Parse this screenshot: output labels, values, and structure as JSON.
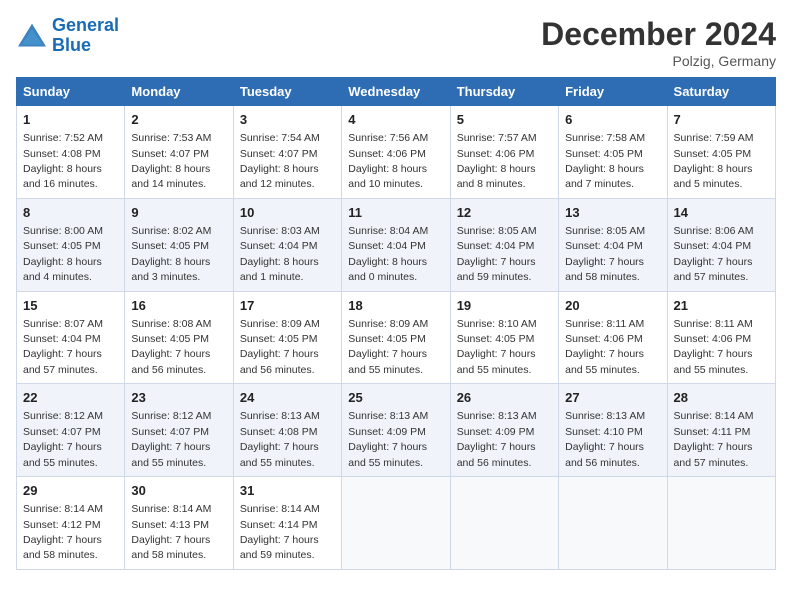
{
  "header": {
    "logo_general": "General",
    "logo_blue": "Blue",
    "month_title": "December 2024",
    "location": "Polzig, Germany"
  },
  "days_of_week": [
    "Sunday",
    "Monday",
    "Tuesday",
    "Wednesday",
    "Thursday",
    "Friday",
    "Saturday"
  ],
  "weeks": [
    [
      {
        "day": "1",
        "sunrise": "Sunrise: 7:52 AM",
        "sunset": "Sunset: 4:08 PM",
        "daylight": "Daylight: 8 hours and 16 minutes."
      },
      {
        "day": "2",
        "sunrise": "Sunrise: 7:53 AM",
        "sunset": "Sunset: 4:07 PM",
        "daylight": "Daylight: 8 hours and 14 minutes."
      },
      {
        "day": "3",
        "sunrise": "Sunrise: 7:54 AM",
        "sunset": "Sunset: 4:07 PM",
        "daylight": "Daylight: 8 hours and 12 minutes."
      },
      {
        "day": "4",
        "sunrise": "Sunrise: 7:56 AM",
        "sunset": "Sunset: 4:06 PM",
        "daylight": "Daylight: 8 hours and 10 minutes."
      },
      {
        "day": "5",
        "sunrise": "Sunrise: 7:57 AM",
        "sunset": "Sunset: 4:06 PM",
        "daylight": "Daylight: 8 hours and 8 minutes."
      },
      {
        "day": "6",
        "sunrise": "Sunrise: 7:58 AM",
        "sunset": "Sunset: 4:05 PM",
        "daylight": "Daylight: 8 hours and 7 minutes."
      },
      {
        "day": "7",
        "sunrise": "Sunrise: 7:59 AM",
        "sunset": "Sunset: 4:05 PM",
        "daylight": "Daylight: 8 hours and 5 minutes."
      }
    ],
    [
      {
        "day": "8",
        "sunrise": "Sunrise: 8:00 AM",
        "sunset": "Sunset: 4:05 PM",
        "daylight": "Daylight: 8 hours and 4 minutes."
      },
      {
        "day": "9",
        "sunrise": "Sunrise: 8:02 AM",
        "sunset": "Sunset: 4:05 PM",
        "daylight": "Daylight: 8 hours and 3 minutes."
      },
      {
        "day": "10",
        "sunrise": "Sunrise: 8:03 AM",
        "sunset": "Sunset: 4:04 PM",
        "daylight": "Daylight: 8 hours and 1 minute."
      },
      {
        "day": "11",
        "sunrise": "Sunrise: 8:04 AM",
        "sunset": "Sunset: 4:04 PM",
        "daylight": "Daylight: 8 hours and 0 minutes."
      },
      {
        "day": "12",
        "sunrise": "Sunrise: 8:05 AM",
        "sunset": "Sunset: 4:04 PM",
        "daylight": "Daylight: 7 hours and 59 minutes."
      },
      {
        "day": "13",
        "sunrise": "Sunrise: 8:05 AM",
        "sunset": "Sunset: 4:04 PM",
        "daylight": "Daylight: 7 hours and 58 minutes."
      },
      {
        "day": "14",
        "sunrise": "Sunrise: 8:06 AM",
        "sunset": "Sunset: 4:04 PM",
        "daylight": "Daylight: 7 hours and 57 minutes."
      }
    ],
    [
      {
        "day": "15",
        "sunrise": "Sunrise: 8:07 AM",
        "sunset": "Sunset: 4:04 PM",
        "daylight": "Daylight: 7 hours and 57 minutes."
      },
      {
        "day": "16",
        "sunrise": "Sunrise: 8:08 AM",
        "sunset": "Sunset: 4:05 PM",
        "daylight": "Daylight: 7 hours and 56 minutes."
      },
      {
        "day": "17",
        "sunrise": "Sunrise: 8:09 AM",
        "sunset": "Sunset: 4:05 PM",
        "daylight": "Daylight: 7 hours and 56 minutes."
      },
      {
        "day": "18",
        "sunrise": "Sunrise: 8:09 AM",
        "sunset": "Sunset: 4:05 PM",
        "daylight": "Daylight: 7 hours and 55 minutes."
      },
      {
        "day": "19",
        "sunrise": "Sunrise: 8:10 AM",
        "sunset": "Sunset: 4:05 PM",
        "daylight": "Daylight: 7 hours and 55 minutes."
      },
      {
        "day": "20",
        "sunrise": "Sunrise: 8:11 AM",
        "sunset": "Sunset: 4:06 PM",
        "daylight": "Daylight: 7 hours and 55 minutes."
      },
      {
        "day": "21",
        "sunrise": "Sunrise: 8:11 AM",
        "sunset": "Sunset: 4:06 PM",
        "daylight": "Daylight: 7 hours and 55 minutes."
      }
    ],
    [
      {
        "day": "22",
        "sunrise": "Sunrise: 8:12 AM",
        "sunset": "Sunset: 4:07 PM",
        "daylight": "Daylight: 7 hours and 55 minutes."
      },
      {
        "day": "23",
        "sunrise": "Sunrise: 8:12 AM",
        "sunset": "Sunset: 4:07 PM",
        "daylight": "Daylight: 7 hours and 55 minutes."
      },
      {
        "day": "24",
        "sunrise": "Sunrise: 8:13 AM",
        "sunset": "Sunset: 4:08 PM",
        "daylight": "Daylight: 7 hours and 55 minutes."
      },
      {
        "day": "25",
        "sunrise": "Sunrise: 8:13 AM",
        "sunset": "Sunset: 4:09 PM",
        "daylight": "Daylight: 7 hours and 55 minutes."
      },
      {
        "day": "26",
        "sunrise": "Sunrise: 8:13 AM",
        "sunset": "Sunset: 4:09 PM",
        "daylight": "Daylight: 7 hours and 56 minutes."
      },
      {
        "day": "27",
        "sunrise": "Sunrise: 8:13 AM",
        "sunset": "Sunset: 4:10 PM",
        "daylight": "Daylight: 7 hours and 56 minutes."
      },
      {
        "day": "28",
        "sunrise": "Sunrise: 8:14 AM",
        "sunset": "Sunset: 4:11 PM",
        "daylight": "Daylight: 7 hours and 57 minutes."
      }
    ],
    [
      {
        "day": "29",
        "sunrise": "Sunrise: 8:14 AM",
        "sunset": "Sunset: 4:12 PM",
        "daylight": "Daylight: 7 hours and 58 minutes."
      },
      {
        "day": "30",
        "sunrise": "Sunrise: 8:14 AM",
        "sunset": "Sunset: 4:13 PM",
        "daylight": "Daylight: 7 hours and 58 minutes."
      },
      {
        "day": "31",
        "sunrise": "Sunrise: 8:14 AM",
        "sunset": "Sunset: 4:14 PM",
        "daylight": "Daylight: 7 hours and 59 minutes."
      },
      null,
      null,
      null,
      null
    ]
  ]
}
